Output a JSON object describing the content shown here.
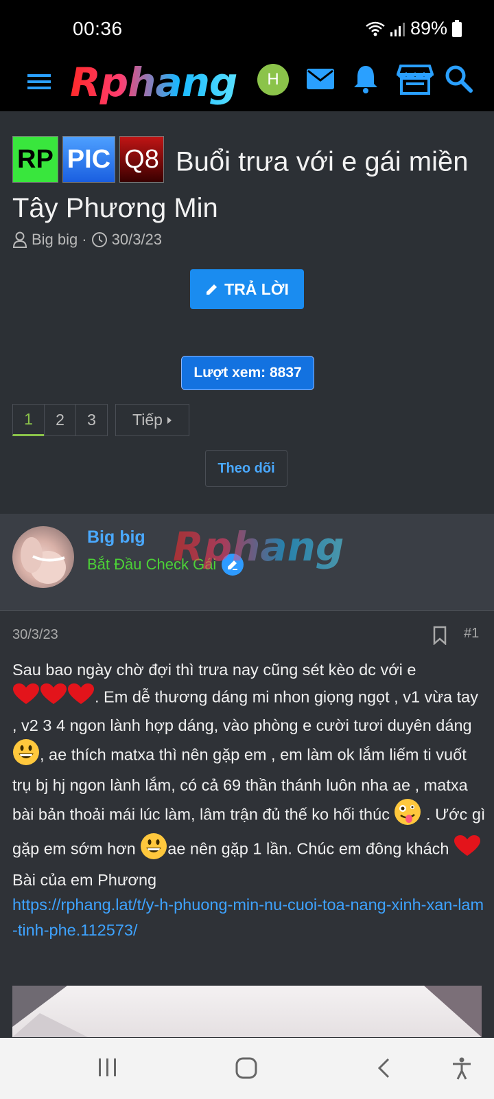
{
  "status": {
    "time": "00:36",
    "battery": "89%"
  },
  "header": {
    "logo": "Rphang",
    "avatar_letter": "H"
  },
  "thread": {
    "prefixes": [
      "RP",
      "PIC",
      "Q8"
    ],
    "title": "Buổi trưa với e gái miền Tây Phương Min",
    "author": "Big big",
    "date": "30/3/23",
    "reply_label": "TRẢ LỜI",
    "views_label": "Lượt xem: 8837",
    "pages": [
      "1",
      "2",
      "3"
    ],
    "next_label": "Tiếp",
    "follow_label": "Theo dõi"
  },
  "post": {
    "user_name": "Big big",
    "user_rank": "Bắt Đầu Check Gái",
    "watermark": "Rphang",
    "date": "30/3/23",
    "number": "#1",
    "text_1": "Sau bao ngày chờ đợi thì trưa nay cũng sét kèo dc với e ",
    "text_2": ". Em dễ thương dáng mi nhon giọng ngọt , v1 vừa tay , v2 3 4 ngon lành hợp dáng, vào phòng e cười tươi duyên dáng ",
    "text_3": ", ae thích matxa thì nên gặp em , em làm ok lắm liếm ti vuốt trụ bj hj ngon lành lắm, có cả 69 thần thánh luôn nha ae , matxa bài bản thoải mái lúc làm, lâm trận đủ thế ko hối thúc ",
    "text_4": " . Ước gì gặp em sớm hơn ",
    "text_5": "ae nên gặp 1 lần. Chúc em đông khách ",
    "text_6": "Bài của em Phương",
    "link": "https://rphang.lat/t/y-h-phuong-min-nu-cuoi-toa-nang-xinh-xan-lam-tinh-phe.112573/"
  },
  "colors": {
    "accent": "#1a8cf0",
    "link": "#3ea3ff",
    "rank": "#4cd137",
    "active_page": "#8bc34a"
  }
}
